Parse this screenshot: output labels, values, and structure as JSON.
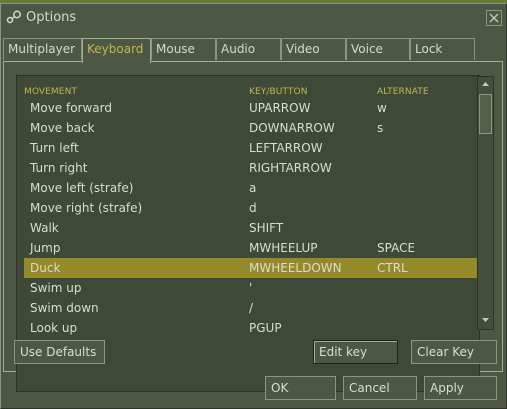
{
  "window": {
    "title": "Options"
  },
  "tabs": [
    {
      "label": "Multiplayer",
      "active": false
    },
    {
      "label": "Keyboard",
      "active": true
    },
    {
      "label": "Mouse",
      "active": false
    },
    {
      "label": "Audio",
      "active": false
    },
    {
      "label": "Video",
      "active": false
    },
    {
      "label": "Voice",
      "active": false
    },
    {
      "label": "Lock",
      "active": false
    }
  ],
  "keylist": {
    "headers": {
      "action": "MOVEMENT",
      "key": "KEY/BUTTON",
      "alternate": "ALTERNATE"
    },
    "rows": [
      {
        "action": "Move forward",
        "key": "UPARROW",
        "alternate": "w",
        "selected": false
      },
      {
        "action": "Move back",
        "key": "DOWNARROW",
        "alternate": "s",
        "selected": false
      },
      {
        "action": "Turn left",
        "key": "LEFTARROW",
        "alternate": "",
        "selected": false
      },
      {
        "action": "Turn right",
        "key": "RIGHTARROW",
        "alternate": "",
        "selected": false
      },
      {
        "action": "Move left (strafe)",
        "key": "a",
        "alternate": "",
        "selected": false
      },
      {
        "action": "Move right (strafe)",
        "key": "d",
        "alternate": "",
        "selected": false
      },
      {
        "action": "Walk",
        "key": "SHIFT",
        "alternate": "",
        "selected": false
      },
      {
        "action": "Jump",
        "key": "MWHEELUP",
        "alternate": "SPACE",
        "selected": false
      },
      {
        "action": "Duck",
        "key": "MWHEELDOWN",
        "alternate": "CTRL",
        "selected": true
      },
      {
        "action": "Swim up",
        "key": "'",
        "alternate": "",
        "selected": false
      },
      {
        "action": "Swim down",
        "key": "/",
        "alternate": "",
        "selected": false
      },
      {
        "action": "Look up",
        "key": "PGUP",
        "alternate": "",
        "selected": false
      }
    ]
  },
  "buttons": {
    "use_defaults": "Use Defaults",
    "edit_key": "Edit key",
    "clear_key": "Clear Key",
    "ok": "OK",
    "cancel": "Cancel",
    "apply": "Apply"
  },
  "icons": {
    "app": "steam-logo-icon",
    "close": "close-icon",
    "scroll_up": "scroll-up-arrow-icon",
    "scroll_down": "scroll-down-arrow-icon"
  },
  "colors": {
    "background": "#4c5844",
    "list_background": "#3e4a37",
    "header_text": "#c4b550",
    "selection": "#958a2a",
    "text": "#dcdcd0"
  }
}
